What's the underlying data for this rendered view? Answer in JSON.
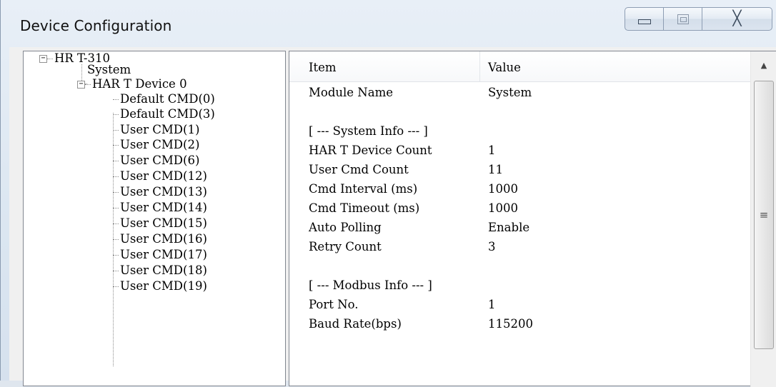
{
  "window": {
    "title": "Device Configuration",
    "minimize_icon": "minimize-icon",
    "maximize_icon": "maximize-icon",
    "close_glyph": "╳"
  },
  "tree": {
    "root": {
      "label": "HR T-310",
      "expander": "−"
    },
    "system": {
      "label": "System"
    },
    "device": {
      "label": "HAR T Device 0",
      "expander": "−"
    },
    "commands": [
      "Default CMD(0)",
      "Default CMD(3)",
      "User CMD(1)",
      "User CMD(2)",
      "User CMD(6)",
      "User CMD(12)",
      "User CMD(13)",
      "User CMD(14)",
      "User CMD(15)",
      "User CMD(16)",
      "User CMD(17)",
      "User CMD(18)",
      "User CMD(19)"
    ]
  },
  "list": {
    "columns": {
      "item": "Item",
      "value": "Value"
    },
    "rows": [
      {
        "item": "Module Name",
        "value": "System"
      },
      {
        "item": "",
        "value": ""
      },
      {
        "item": "[ --- System Info --- ]",
        "value": ""
      },
      {
        "item": "HAR T Device Count",
        "value": "1"
      },
      {
        "item": "User Cmd Count",
        "value": "11"
      },
      {
        "item": "Cmd Interval (ms)",
        "value": "1000"
      },
      {
        "item": "Cmd Timeout (ms)",
        "value": "1000"
      },
      {
        "item": "Auto Polling",
        "value": "Enable"
      },
      {
        "item": "Retry Count",
        "value": "3"
      },
      {
        "item": "",
        "value": ""
      },
      {
        "item": "[ --- Modbus Info --- ]",
        "value": ""
      },
      {
        "item": "Port No.",
        "value": "1"
      },
      {
        "item": "Baud Rate(bps)",
        "value": "115200"
      }
    ]
  },
  "scrollbar": {
    "up_glyph": "▲",
    "grip_glyph": "≡"
  }
}
